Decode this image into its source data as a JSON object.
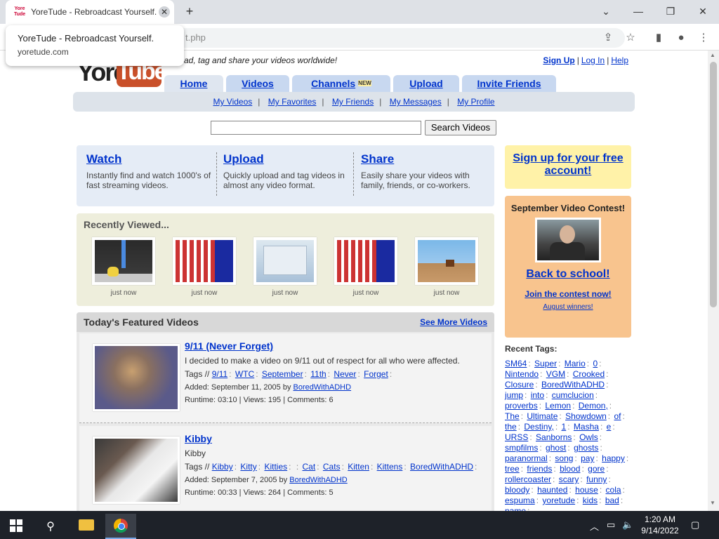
{
  "browser": {
    "tab_title": "YoreTude - Rebroadcast Yourself.",
    "favicon_text": "Yore Tude",
    "tab_close": "✕",
    "new_tab": "+",
    "url_visible": "t.php",
    "tooltip": {
      "title": "YoreTude - Rebroadcast Yourself.",
      "url": "yoretude.com"
    },
    "window": {
      "minimize": "—",
      "restore": "❐",
      "close": "✕",
      "tablist": "⌄"
    },
    "icons": {
      "share": "⇪",
      "star": "☆",
      "sidepanel": "▮",
      "profile": "●",
      "menu": "⋮"
    }
  },
  "header": {
    "logo_you": "Yore",
    "logo_tube": "Tube",
    "tagline": "ad, tag and share your videos worldwide!",
    "userlinks": {
      "signup": "Sign Up",
      "login": "Log In",
      "help": "Help",
      "sep": "|"
    }
  },
  "nav": {
    "tabs": [
      {
        "label": "Home"
      },
      {
        "label": "Videos"
      },
      {
        "label": "Channels",
        "badge": "NEW"
      },
      {
        "label": "Upload"
      },
      {
        "label": "Invite Friends"
      }
    ],
    "sub": [
      "My Videos",
      "My Favorites",
      "My Friends",
      "My Messages",
      "My Profile"
    ],
    "sub_sep": "|"
  },
  "search": {
    "value": "",
    "button": "Search Videos"
  },
  "intro": [
    {
      "title": "Watch",
      "text": "Instantly find and watch 1000's of fast streaming videos."
    },
    {
      "title": "Upload",
      "text": "Quickly upload and tag videos in almost any video format."
    },
    {
      "title": "Share",
      "text": "Easily share your videos with family, friends, or co-workers."
    }
  ],
  "signup_box": {
    "text": "Sign up for your free account!"
  },
  "contest": {
    "title": "September Video Contest!",
    "link": "Back to school!",
    "join": "Join the contest now!",
    "winners": "August winners!"
  },
  "recent": {
    "title": "Recently Viewed...",
    "items": [
      {
        "time": "just now"
      },
      {
        "time": "just now"
      },
      {
        "time": "just now"
      },
      {
        "time": "just now"
      },
      {
        "time": "just now"
      }
    ]
  },
  "featured": {
    "title": "Today's Featured Videos",
    "see_more": "See More Videos",
    "tags_prefix": "Tags //",
    "videos": [
      {
        "title": "9/11 (Never Forget)",
        "desc": "I decided to make a video on 9/11 out of respect for all who were affected.",
        "tags": [
          "9/11",
          "WTC",
          "September",
          "11th",
          "Never",
          "Forget"
        ],
        "added_prefix": "Added: September 11, 2005 by",
        "user": "BoredWithADHD",
        "stats": "Runtime: 03:10 | Views: 195 | Comments: 6"
      },
      {
        "title": "Kibby",
        "desc": "Kibby",
        "tags": [
          "Kibby",
          "Kitty",
          "Kitties",
          "",
          "Cat",
          "Cats",
          "Kitten",
          "Kittens",
          "BoredWithADHD"
        ],
        "added_prefix": "Added: September 7, 2005 by",
        "user": "BoredWithADHD",
        "stats": "Runtime: 00:33 | Views: 264 | Comments: 5"
      }
    ]
  },
  "recent_tags": {
    "title": "Recent Tags:",
    "tags": [
      "SM64",
      "Super",
      "Mario",
      "0",
      "Nintendo",
      "VGM",
      "Crooked",
      "Closure",
      "BoredWithADHD",
      "jump",
      "into",
      "cumclucion",
      "proverbs",
      "Lemon",
      "Demon,",
      "The",
      "Ultimate",
      "Showdown",
      "of",
      "the",
      "Destiny,",
      "1",
      "Masha",
      "e",
      "URSS",
      "Sanborns",
      "Owls",
      "smpfilms",
      "ghost",
      "ghosts",
      "paranormal",
      "song",
      "pay",
      "happy",
      "tree",
      "friends",
      "blood",
      "gore",
      "rollercoaster",
      "scary",
      "funny",
      "bloody",
      "haunted",
      "house",
      "cola",
      "espuma",
      "yoretude",
      "kids",
      "bad",
      "name"
    ]
  },
  "taskbar": {
    "search_icon": "⚲",
    "tray_up": "︿",
    "tray_net": "▭",
    "tray_vol": "🔈",
    "time": "1:20 AM",
    "date": "9/14/2022",
    "notif": "▢"
  }
}
